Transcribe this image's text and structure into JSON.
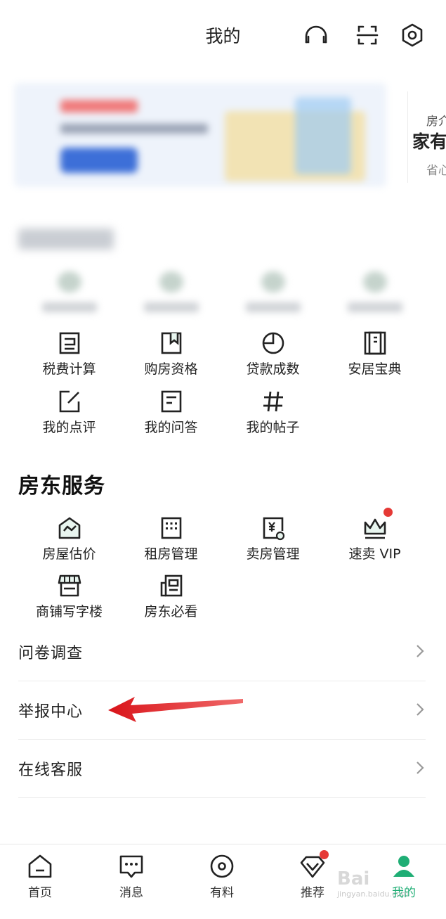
{
  "header": {
    "title": "我的"
  },
  "banner": {
    "next_card": {
      "line1": "房介",
      "line2": "家有",
      "line3": "省心"
    }
  },
  "tools": {
    "row1": [
      {
        "label": "税费计算",
        "icon": "tax-calc-icon"
      },
      {
        "label": "购房资格",
        "icon": "bookmark-doc-icon"
      },
      {
        "label": "贷款成数",
        "icon": "pie-chart-icon"
      },
      {
        "label": "安居宝典",
        "icon": "book-icon"
      }
    ],
    "row2": [
      {
        "label": "我的点评",
        "icon": "edit-icon"
      },
      {
        "label": "我的问答",
        "icon": "qa-doc-icon"
      },
      {
        "label": "我的帖子",
        "icon": "hashtag-icon"
      }
    ]
  },
  "landlord": {
    "title": "房东服务",
    "row1": [
      {
        "label": "房屋估价",
        "icon": "house-chart-icon"
      },
      {
        "label": "租房管理",
        "icon": "building-icon"
      },
      {
        "label": "卖房管理",
        "icon": "yuan-doc-icon"
      },
      {
        "label": "速卖 VIP",
        "icon": "crown-icon",
        "badge": true
      }
    ],
    "row2": [
      {
        "label": "商铺写字楼",
        "icon": "shop-icon"
      },
      {
        "label": "房东必看",
        "icon": "newspaper-icon"
      }
    ]
  },
  "list": [
    {
      "label": "问卷调查"
    },
    {
      "label": "举报中心"
    },
    {
      "label": "在线客服"
    }
  ],
  "tabbar": [
    {
      "label": "首页",
      "icon": "home-icon"
    },
    {
      "label": "消息",
      "icon": "message-icon"
    },
    {
      "label": "有料",
      "icon": "target-icon"
    },
    {
      "label": "推荐",
      "icon": "recommend-icon",
      "badge": true
    },
    {
      "label": "我的",
      "icon": "user-icon",
      "active": true
    }
  ],
  "watermark": {
    "brand": "Bai",
    "url": "jingyan.baidu.com"
  },
  "colors": {
    "accent_green": "#1fae75",
    "badge_red": "#e53935",
    "arrow_red": "#e0261f"
  }
}
